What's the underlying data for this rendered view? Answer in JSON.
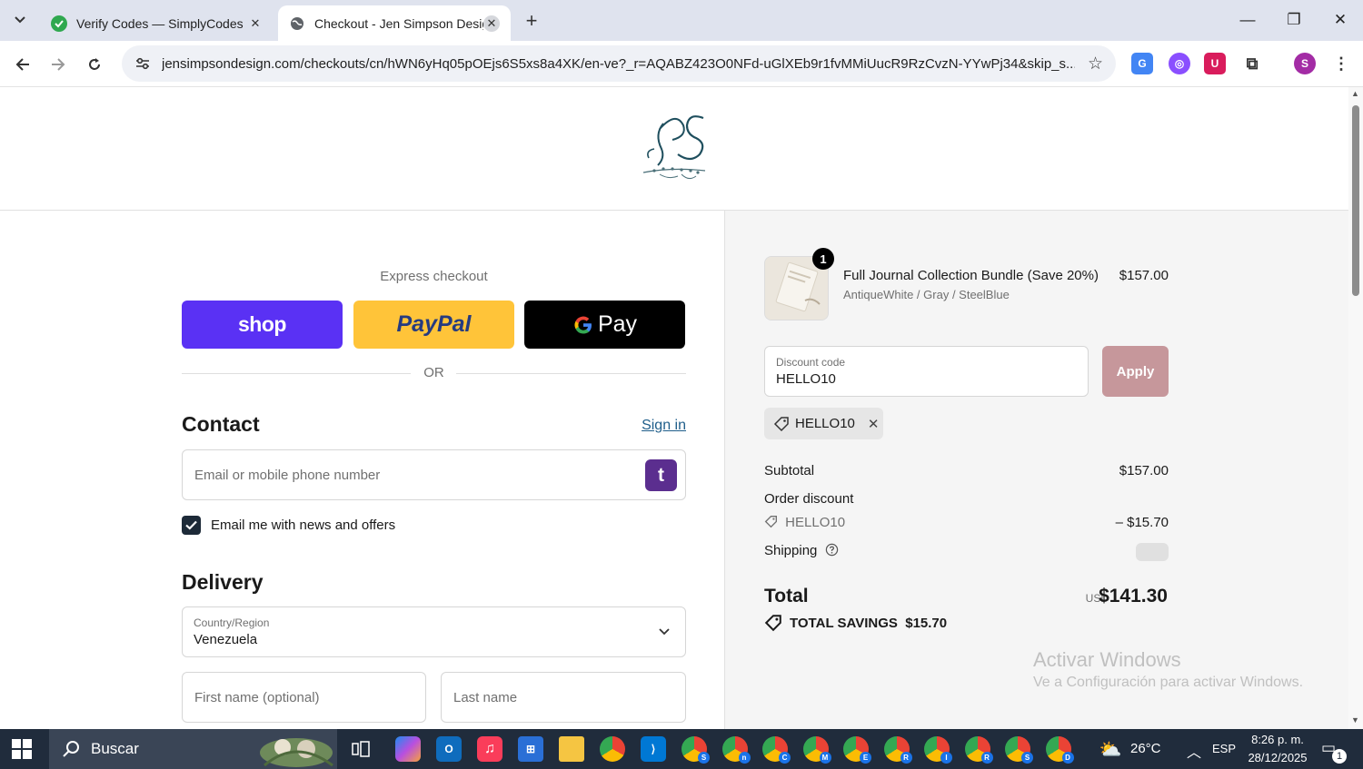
{
  "browser": {
    "tabs": [
      {
        "title": "Verify Codes — SimplyCodes",
        "active": false
      },
      {
        "title": "Checkout - Jen Simpson Design",
        "active": true
      }
    ],
    "url": "jensimpsondesign.com/checkouts/cn/hWN6yHq05pOEjs6S5xs8a4XK/en-ve?_r=AQABZ423O0NFd-uGlXEb9r1fvMMiUucR9RzCvzN-YYwPj34&skip_s...",
    "profile_initial": "S"
  },
  "checkout": {
    "express_label": "Express checkout",
    "shop_label": "shop",
    "paypal_label": "PayPal",
    "gpay_label": "Pay",
    "or_label": "OR",
    "contact_title": "Contact",
    "sign_in": "Sign in",
    "email_placeholder": "Email or mobile phone number",
    "newsletter_label": "Email me with news and offers",
    "delivery_title": "Delivery",
    "country_label": "Country/Region",
    "country_value": "Venezuela",
    "first_name_placeholder": "First name (optional)",
    "last_name_placeholder": "Last name"
  },
  "summary": {
    "quantity": "1",
    "product_name": "Full Journal Collection Bundle (Save 20%)",
    "product_variant": "AntiqueWhite / Gray / SteelBlue",
    "product_price": "$157.00",
    "discount_label": "Discount code",
    "discount_value": "HELLO10",
    "apply_label": "Apply",
    "applied_code": "HELLO10",
    "subtotal_label": "Subtotal",
    "subtotal_value": "$157.00",
    "order_discount_label": "Order discount",
    "order_discount_code": "HELLO10",
    "order_discount_value": "– $15.70",
    "shipping_label": "Shipping",
    "total_label": "Total",
    "currency": "USD",
    "total_value": "$141.30",
    "savings_text": "TOTAL SAVINGS  $15.70"
  },
  "watermark": {
    "line1": "Activar Windows",
    "line2": "Ve a Configuración para activar Windows."
  },
  "taskbar": {
    "search_label": "Buscar",
    "temperature": "26°C",
    "language": "ESP",
    "time": "8:26 p. m.",
    "date": "28/12/2025",
    "notification_count": "1",
    "chrome_profile_letters": [
      "S",
      "n",
      "C",
      "M",
      "E",
      "R",
      "I",
      "R",
      "S",
      "D"
    ]
  },
  "colors": {
    "shop_purple": "#5a31f4",
    "paypal_yellow": "#ffc439",
    "apply_button": "#c6979b",
    "link_blue": "#1f5e8a"
  }
}
